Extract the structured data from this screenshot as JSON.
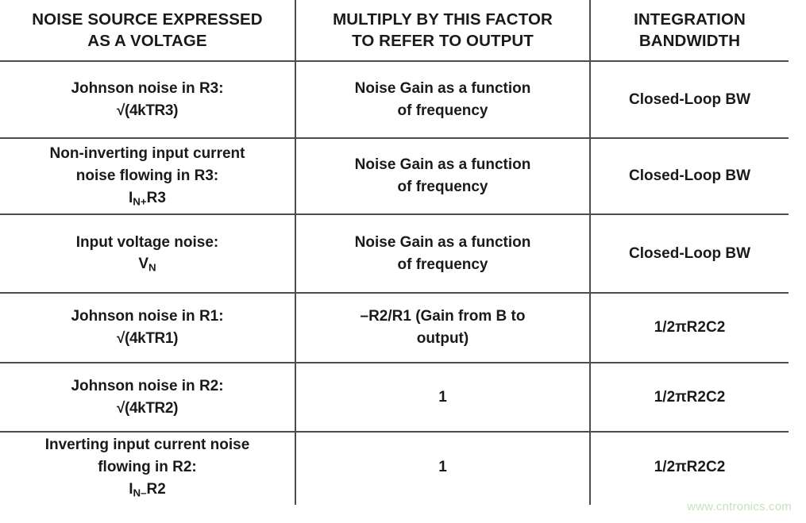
{
  "table": {
    "headers": [
      {
        "line1": "NOISE SOURCE EXPRESSED",
        "line2": "AS A VOLTAGE"
      },
      {
        "line1": "MULTIPLY BY THIS FACTOR",
        "line2": "TO REFER TO OUTPUT"
      },
      {
        "line1": "INTEGRATION",
        "line2": "BANDWIDTH"
      }
    ],
    "rows": [
      {
        "source_line1": "Johnson noise in R3:",
        "source_line2": "√(4kTR3)",
        "source_line3": "",
        "factor_line1": "Noise Gain as a function",
        "factor_line2": "of frequency",
        "bandwidth": "Closed-Loop BW"
      },
      {
        "source_line1": "Non-inverting input current",
        "source_line2": "noise flowing in R3:",
        "source_line3": "I|N+|R3",
        "factor_line1": "Noise Gain as a function",
        "factor_line2": "of frequency",
        "bandwidth": "Closed-Loop BW"
      },
      {
        "source_line1": "Input voltage noise:",
        "source_line2": "V|N|",
        "source_line3": "",
        "factor_line1": "Noise Gain as a function",
        "factor_line2": "of frequency",
        "bandwidth": "Closed-Loop BW"
      },
      {
        "source_line1": "Johnson noise in R1:",
        "source_line2": "√(4kTR1)",
        "source_line3": "",
        "factor_line1": "–R2/R1 (Gain from B to",
        "factor_line2": "output)",
        "bandwidth": "1/2πR2C2"
      },
      {
        "source_line1": "Johnson noise in R2:",
        "source_line2": "√(4kTR2)",
        "source_line3": "",
        "factor_line1": "1",
        "factor_line2": "",
        "bandwidth": "1/2πR2C2"
      },
      {
        "source_line1": "Inverting input current noise",
        "source_line2": "flowing in R2:",
        "source_line3": "I|N–|R2",
        "factor_line1": "1",
        "factor_line2": "",
        "bandwidth": "1/2πR2C2"
      }
    ]
  },
  "watermark": {
    "text": "www.cntronics.com",
    "color": "#c6e2bd"
  },
  "colors": {
    "rule": "#4d4d4d",
    "text": "#1a1a1a",
    "background": "#ffffff"
  }
}
